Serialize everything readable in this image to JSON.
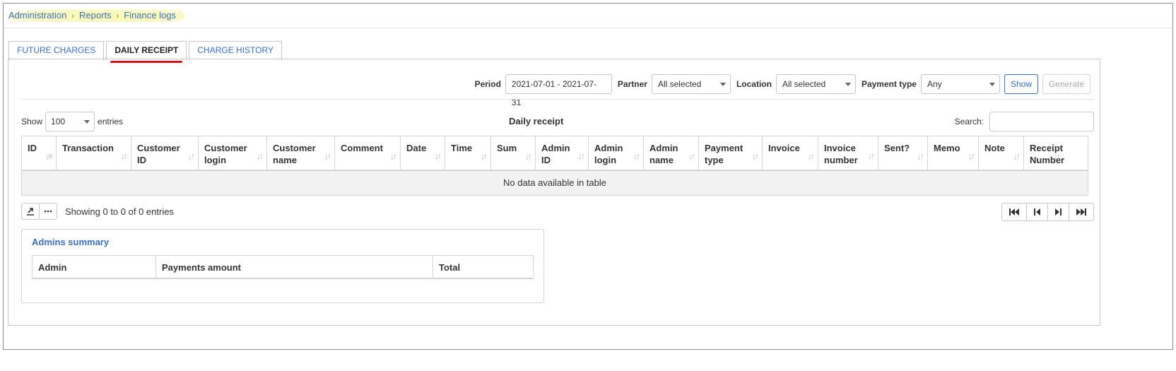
{
  "breadcrumb": {
    "items": [
      "Administration",
      "Reports"
    ],
    "current": "Finance logs",
    "separator": "›"
  },
  "tabs": [
    {
      "label": "FUTURE CHARGES",
      "active": false
    },
    {
      "label": "DAILY RECEIPT",
      "active": true
    },
    {
      "label": "CHARGE HISTORY",
      "active": false
    }
  ],
  "filters": {
    "period_label": "Period",
    "period_value": "2021-07-01 - 2021-07-31",
    "partner_label": "Partner",
    "partner_value": "All selected",
    "location_label": "Location",
    "location_value": "All selected",
    "payment_type_label": "Payment type",
    "payment_type_value": "Any",
    "show_label": "Show",
    "generate_label": "Generate"
  },
  "table": {
    "length_prefix": "Show",
    "length_value": "100",
    "length_suffix": "entries",
    "title": "Daily receipt",
    "search_label": "Search:",
    "columns": [
      [
        "ID"
      ],
      [
        "Transaction"
      ],
      [
        "Customer",
        "ID"
      ],
      [
        "Customer",
        "login"
      ],
      [
        "Customer",
        "name"
      ],
      [
        "Comment"
      ],
      [
        "Date"
      ],
      [
        "Time"
      ],
      [
        "Sum"
      ],
      [
        "Admin",
        "ID"
      ],
      [
        "Admin",
        "login"
      ],
      [
        "Admin",
        "name"
      ],
      [
        "Payment",
        "type"
      ],
      [
        "Invoice"
      ],
      [
        "Invoice",
        "number"
      ],
      [
        "Sent?"
      ],
      [
        "Memo"
      ],
      [
        "Note"
      ],
      [
        "Receipt",
        "Number"
      ]
    ],
    "empty_text": "No data available in table",
    "info": "Showing 0 to 0 of 0 entries"
  },
  "summary": {
    "title": "Admins summary",
    "columns": [
      "Admin",
      "Payments amount",
      "Total"
    ]
  },
  "colors": {
    "link": "#3b6fc2",
    "active_tab_underline": "#d0161b",
    "breadcrumb_highlight": "#fbfab0"
  }
}
